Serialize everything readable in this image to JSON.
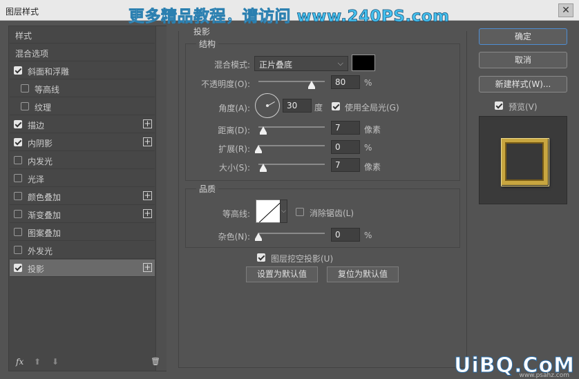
{
  "window": {
    "title": "图层样式",
    "close_glyph": "✕"
  },
  "watermark": {
    "text": "更多精品教程，请访问 ",
    "url": "www.240PS.com",
    "bottom": "UiBQ.CoM",
    "bottom_sub": "www.psahz.com"
  },
  "left_panel": {
    "items": [
      {
        "label": "样式",
        "checkbox": false,
        "checked": false,
        "plus": false,
        "indent": false,
        "selected": false
      },
      {
        "label": "混合选项",
        "checkbox": false,
        "checked": false,
        "plus": false,
        "indent": false,
        "selected": false
      },
      {
        "label": "斜面和浮雕",
        "checkbox": true,
        "checked": true,
        "plus": false,
        "indent": false,
        "selected": false
      },
      {
        "label": "等高线",
        "checkbox": true,
        "checked": false,
        "plus": false,
        "indent": true,
        "selected": false
      },
      {
        "label": "纹理",
        "checkbox": true,
        "checked": false,
        "plus": false,
        "indent": true,
        "selected": false
      },
      {
        "label": "描边",
        "checkbox": true,
        "checked": true,
        "plus": true,
        "indent": false,
        "selected": false
      },
      {
        "label": "内阴影",
        "checkbox": true,
        "checked": true,
        "plus": true,
        "indent": false,
        "selected": false
      },
      {
        "label": "内发光",
        "checkbox": true,
        "checked": false,
        "plus": false,
        "indent": false,
        "selected": false
      },
      {
        "label": "光泽",
        "checkbox": true,
        "checked": false,
        "plus": false,
        "indent": false,
        "selected": false
      },
      {
        "label": "颜色叠加",
        "checkbox": true,
        "checked": false,
        "plus": true,
        "indent": false,
        "selected": false
      },
      {
        "label": "渐变叠加",
        "checkbox": true,
        "checked": false,
        "plus": true,
        "indent": false,
        "selected": false
      },
      {
        "label": "图案叠加",
        "checkbox": true,
        "checked": false,
        "plus": false,
        "indent": false,
        "selected": false
      },
      {
        "label": "外发光",
        "checkbox": true,
        "checked": false,
        "plus": false,
        "indent": false,
        "selected": false
      },
      {
        "label": "投影",
        "checkbox": true,
        "checked": true,
        "plus": true,
        "indent": false,
        "selected": true
      }
    ],
    "footer": {
      "fx": "fx",
      "up": "⬆",
      "down": "⬇",
      "trash": "🗑"
    }
  },
  "main": {
    "group_title": "投影",
    "structure": {
      "title": "结构",
      "blend_mode_label": "混合模式:",
      "blend_mode_value": "正片叠底",
      "opacity_label": "不透明度(O):",
      "opacity_value": "80",
      "opacity_unit": "%",
      "angle_label": "角度(A):",
      "angle_value": "30",
      "angle_unit": "度",
      "global_light_label": "使用全局光(G)",
      "global_light_checked": true,
      "distance_label": "距离(D):",
      "distance_value": "7",
      "distance_unit": "像素",
      "spread_label": "扩展(R):",
      "spread_value": "0",
      "spread_unit": "%",
      "size_label": "大小(S):",
      "size_value": "7",
      "size_unit": "像素",
      "shadow_color": "#000000"
    },
    "quality": {
      "title": "品质",
      "contour_label": "等高线:",
      "antialias_label": "消除锯齿(L)",
      "antialias_checked": false,
      "noise_label": "杂色(N):",
      "noise_value": "0",
      "noise_unit": "%"
    },
    "knockout_label": "图层挖空投影(U)",
    "knockout_checked": true,
    "make_default_label": "设置为默认值",
    "reset_default_label": "复位为默认值"
  },
  "right_panel": {
    "ok_label": "确定",
    "cancel_label": "取消",
    "new_style_label": "新建样式(W)...",
    "preview_label": "预览(V)",
    "preview_checked": true
  }
}
